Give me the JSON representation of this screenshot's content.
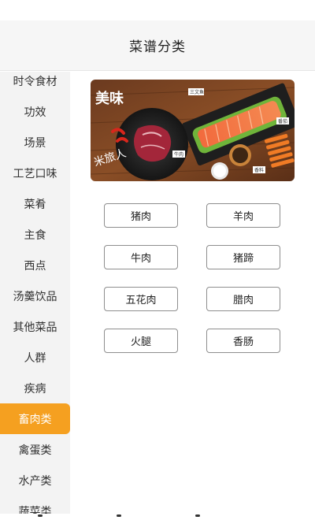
{
  "header": {
    "title": "菜谱分类"
  },
  "sidebar": {
    "items": [
      {
        "label": "时令食材"
      },
      {
        "label": "功效"
      },
      {
        "label": "场景"
      },
      {
        "label": "工艺口味"
      },
      {
        "label": "菜肴"
      },
      {
        "label": "主食"
      },
      {
        "label": "西点"
      },
      {
        "label": "汤羹饮品"
      },
      {
        "label": "其他菜品"
      },
      {
        "label": "人群"
      },
      {
        "label": "疾病"
      },
      {
        "label": "畜肉类"
      },
      {
        "label": "禽蛋类"
      },
      {
        "label": "水产类"
      },
      {
        "label": "蔬菜类"
      }
    ],
    "active_index": 11
  },
  "banner": {
    "brand_text": "美味",
    "brand_text2": "米旅人",
    "tags": [
      "三文鱼",
      "牛肉",
      "香料",
      "番茄"
    ]
  },
  "categories": [
    {
      "label": "猪肉"
    },
    {
      "label": "羊肉"
    },
    {
      "label": "牛肉"
    },
    {
      "label": "猪蹄"
    },
    {
      "label": "五花肉"
    },
    {
      "label": "腊肉"
    },
    {
      "label": "火腿"
    },
    {
      "label": "香肠"
    }
  ],
  "colors": {
    "accent": "#f5a020",
    "sidebar_bg": "#f3f3f3",
    "header_bg": "#f6f6f6"
  }
}
